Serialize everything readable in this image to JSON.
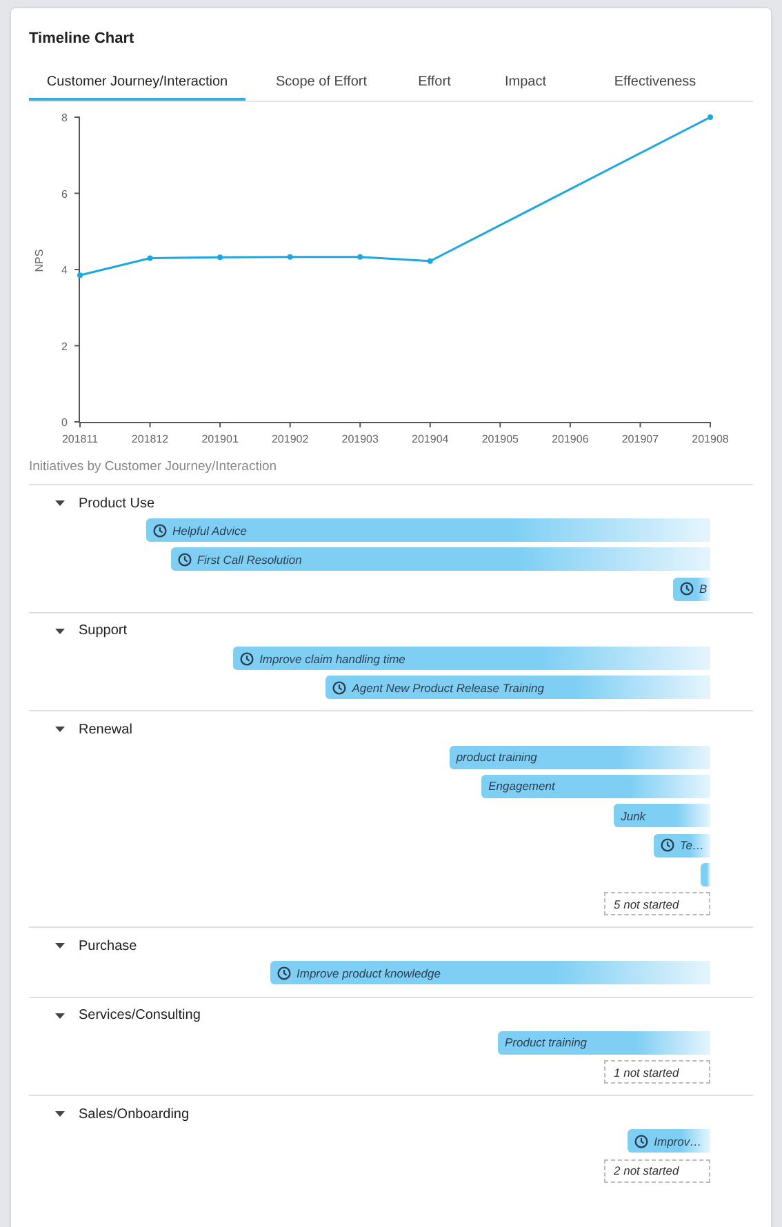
{
  "card": {
    "title": "Timeline Chart"
  },
  "tabs": [
    {
      "label": "Customer Journey/Interaction",
      "selected": true
    },
    {
      "label": "Scope of Effort",
      "selected": false
    },
    {
      "label": "Effort",
      "selected": false
    },
    {
      "label": "Impact",
      "selected": false
    },
    {
      "label": "Effectiveness",
      "selected": false
    }
  ],
  "chart": {
    "chart_data": {
      "type": "line",
      "ylabel": "NPS",
      "categories": [
        "201811",
        "201812",
        "201901",
        "201902",
        "201903",
        "201904",
        "201905",
        "201906",
        "201907",
        "201908"
      ],
      "ylim": [
        0,
        8
      ],
      "yticks": [
        0,
        2,
        4,
        6,
        8
      ],
      "series": [
        {
          "color": "#1ba8e0",
          "marker": "circle",
          "values": [
            3.85,
            4.3,
            4.32,
            4.33,
            4.33,
            4.22,
            null,
            null,
            null,
            8.0
          ]
        }
      ]
    }
  },
  "initiatives": {
    "heading": "Initiatives by Customer Journey/Interaction",
    "groups": [
      {
        "name": "Product Use",
        "expanded": true,
        "bars": [
          {
            "label": "Helpful Advice",
            "kind": "scheduled"
          },
          {
            "label": "First Call Resolution",
            "kind": "scheduled"
          },
          {
            "label": "B",
            "kind": "scheduled"
          }
        ]
      },
      {
        "name": "Support",
        "expanded": true,
        "bars": [
          {
            "label": "Improve claim handling time",
            "kind": "scheduled"
          },
          {
            "label": "Agent New Product Release Training",
            "kind": "scheduled"
          }
        ]
      },
      {
        "name": "Renewal",
        "expanded": true,
        "bars": [
          {
            "label": "product training",
            "kind": "plain"
          },
          {
            "label": "Engagement",
            "kind": "plain"
          },
          {
            "label": "Junk",
            "kind": "plain"
          },
          {
            "label": "Te…",
            "kind": "scheduled"
          },
          {
            "kind": "plain"
          }
        ],
        "not_started": "5 not started"
      },
      {
        "name": "Purchase",
        "expanded": true,
        "bars": [
          {
            "label": "Improve product knowledge",
            "kind": "scheduled"
          }
        ]
      },
      {
        "name": "Services/Consulting",
        "expanded": true,
        "bars": [
          {
            "label": "Product training",
            "kind": "plain"
          }
        ],
        "not_started": "1 not started"
      },
      {
        "name": "Sales/Onboarding",
        "expanded": true,
        "bars": [
          {
            "label": "Improv…",
            "kind": "scheduled"
          }
        ],
        "not_started": "2 not started"
      }
    ]
  }
}
